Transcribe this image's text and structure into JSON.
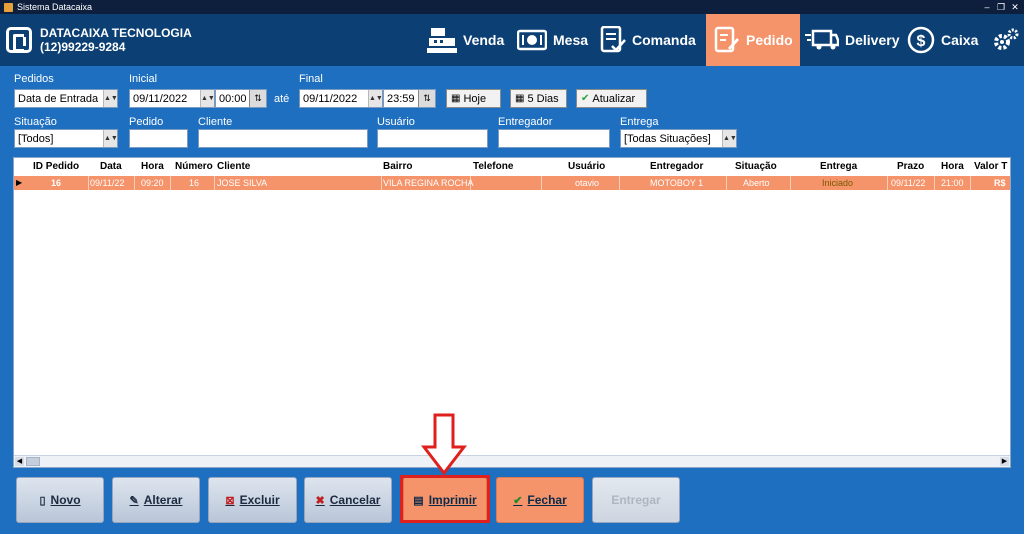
{
  "window": {
    "title": "Sistema Datacaixa"
  },
  "company": {
    "name": "DATACAIXA TECNOLOGIA",
    "phone": "(12)99229-9284"
  },
  "nav": {
    "venda": "Venda",
    "mesa": "Mesa",
    "comanda": "Comanda",
    "pedido": "Pedido",
    "delivery": "Delivery",
    "caixa": "Caixa",
    "active": "Pedido",
    "active_color": "#f5936a"
  },
  "filters": {
    "pedidos_label": "Pedidos",
    "pedidos_value": "Data de Entrada",
    "inicial_label": "Inicial",
    "inicial_date": "09/11/2022",
    "inicial_time": "00:00",
    "ate": "até",
    "final_label": "Final",
    "final_date": "09/11/2022",
    "final_time": "23:59",
    "hoje": "Hoje",
    "cinco_dias": "5 Dias",
    "atualizar": "Atualizar",
    "situacao_label": "Situação",
    "situacao_value": "[Todos]",
    "pedido_label": "Pedido",
    "pedido_value": "",
    "cliente_label": "Cliente",
    "cliente_value": "",
    "usuario_label": "Usuário",
    "usuario_value": "",
    "entregador_label": "Entregador",
    "entregador_value": "",
    "entrega_label": "Entrega",
    "entrega_value": "[Todas Situações]"
  },
  "grid": {
    "headers": [
      "ID Pedido",
      "Data",
      "Hora",
      "Número",
      "Cliente",
      "Bairro",
      "Telefone",
      "Usuário",
      "Entregador",
      "Situação",
      "Entrega",
      "Prazo",
      "Hora",
      "Valor T"
    ],
    "rows": [
      [
        "16",
        "09/11/22",
        "09:20",
        "16",
        "JOSE SILVA",
        "VILA REGINA ROCHA",
        "",
        "otavio",
        "MOTOBOY 1",
        "Aberto",
        "Iniciado",
        "09/11/22",
        "21:00",
        "R$"
      ]
    ],
    "row_color": "#f5936a"
  },
  "buttons": {
    "novo": "Novo",
    "alterar": "Alterar",
    "excluir": "Excluir",
    "cancelar": "Cancelar",
    "imprimir": "Imprimir",
    "fechar": "Fechar",
    "entregar": "Entregar"
  },
  "colors": {
    "background": "#1e6fc0",
    "header": "#0c3f73",
    "highlight": "#e0201c"
  }
}
